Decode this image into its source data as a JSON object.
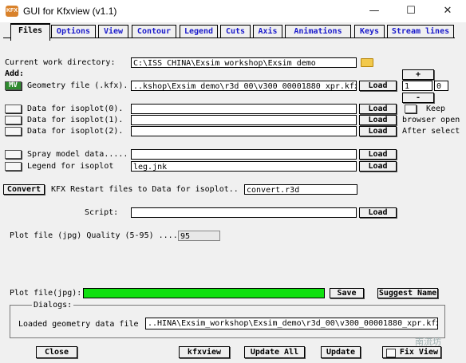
{
  "window": {
    "title": "GUI for Kfxview (v1.1)",
    "app_icon_text": "KFX",
    "minimize_glyph": "—",
    "maximize_glyph": "☐",
    "close_glyph": "✕"
  },
  "tabs": [
    "Files",
    "Options",
    "View",
    "Contour",
    "Legend",
    "Cuts",
    "Axis",
    "Animations",
    "Keys",
    "Stream lines"
  ],
  "files": {
    "cwd_label": "Current work directory:",
    "cwd_value": "C:\\ISS_CHINA\\Exsim_workshop\\Exsim_demo",
    "add_label": "Add:",
    "geometry_check": "MV",
    "geometry_label": "Geometry file (.kfx).",
    "geometry_value": "..kshop\\Exsim_demo\\r3d_00\\v300_00001880_xpr.kfx",
    "load_label": "Load",
    "spin_plus": "+",
    "spin_minus": "-",
    "spin_value1": "1",
    "spin_value2": "0",
    "iso0_label": "Data for isoplot(0).",
    "iso1_label": "Data for isoplot(1).",
    "iso2_label": "Data for isoplot(2).",
    "keep_label": "Keep",
    "browser_open_label": "browser open",
    "after_select_label": "After select",
    "spray_label": "Spray model data.....",
    "legend_label": "Legend for isoplot",
    "legend_value": "leg.jnk",
    "convert_button": "Convert",
    "restart_label": "KFX Restart files to Data for isoplot..",
    "convert_value": "convert.r3d",
    "script_label": "Script:",
    "quality_label": "Plot file (jpg) Quality (5-95) ....",
    "quality_value": "95",
    "plotfile_label": "Plot file(jpg):",
    "save_button": "Save",
    "suggest_button": "Suggest Name",
    "dialogs_label": "Dialogs:",
    "loaded_geom_label": "Loaded geometry data file",
    "loaded_geom_value": "..HINA\\Exsim_workshop\\Exsim_demo\\r3d_00\\v300_00001880_xpr.kfx"
  },
  "bottom": {
    "close": "Close",
    "kfxview": "kfxview",
    "update_all": "Update All",
    "update": "Update",
    "fix_view": "Fix View"
  },
  "colors": {
    "progress": "#10e010",
    "tab_text": "#1a1acc",
    "checked": "#2e8b2e"
  },
  "watermark": "南流坊"
}
